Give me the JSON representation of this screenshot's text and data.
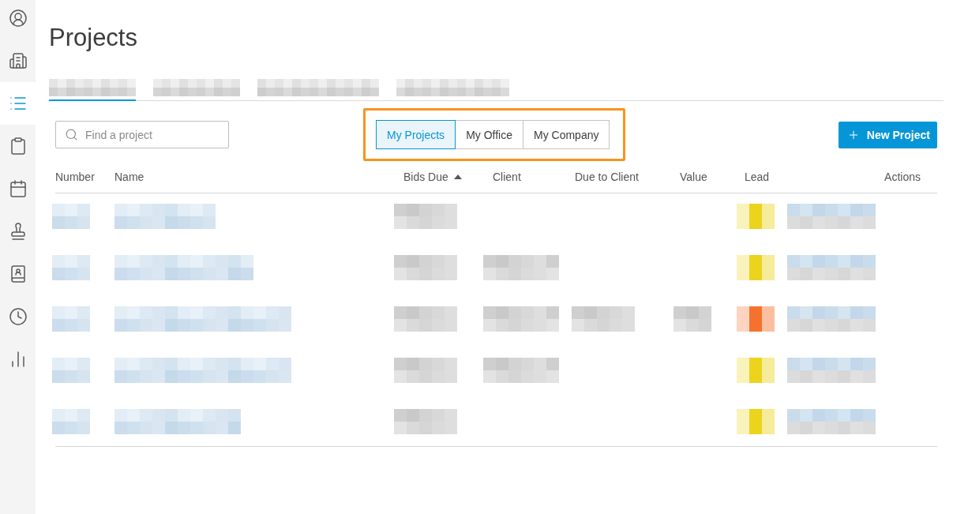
{
  "sidebar": {
    "items": [
      {
        "kind": "profile",
        "selected": false
      },
      {
        "kind": "buildings",
        "selected": false
      },
      {
        "kind": "list",
        "selected": true
      },
      {
        "kind": "clipboard",
        "selected": false
      },
      {
        "kind": "calendar",
        "selected": false
      },
      {
        "kind": "stamp",
        "selected": false
      },
      {
        "kind": "contacts",
        "selected": false
      },
      {
        "kind": "clock",
        "selected": false
      },
      {
        "kind": "chart",
        "selected": false
      }
    ]
  },
  "title": "Projects",
  "tabs": [
    {
      "selected": true
    },
    {
      "selected": false
    },
    {
      "selected": false
    },
    {
      "selected": false
    }
  ],
  "search": {
    "placeholder": "Find a project"
  },
  "scope_filter": {
    "highlighted": true,
    "options": [
      {
        "label": "My Projects",
        "selected": true
      },
      {
        "label": "My Office",
        "selected": false
      },
      {
        "label": "My Company",
        "selected": false
      }
    ]
  },
  "new_project_button": {
    "label": "New Project"
  },
  "table": {
    "columns": [
      {
        "label": "Number",
        "sorted": false
      },
      {
        "label": "Name",
        "sorted": false
      },
      {
        "label": "Bids Due",
        "sorted": true
      },
      {
        "label": "Client",
        "sorted": false
      },
      {
        "label": "Due to Client",
        "sorted": false
      },
      {
        "label": "Value",
        "sorted": false
      },
      {
        "label": "Lead",
        "sorted": false
      },
      {
        "label": "Actions",
        "sorted": false
      }
    ],
    "rows": [
      {
        "cells": [
          {
            "kind": "link"
          },
          {
            "kind": "link"
          },
          {
            "kind": "text"
          },
          {
            "kind": "empty"
          },
          {
            "kind": "empty"
          },
          {
            "kind": "empty"
          },
          {
            "kind": "lead",
            "color": "#ecd31c"
          },
          {
            "kind": "empty"
          }
        ]
      },
      {
        "cells": [
          {
            "kind": "link"
          },
          {
            "kind": "link"
          },
          {
            "kind": "text"
          },
          {
            "kind": "text"
          },
          {
            "kind": "empty"
          },
          {
            "kind": "empty"
          },
          {
            "kind": "lead",
            "color": "#ecd31c"
          },
          {
            "kind": "empty"
          }
        ]
      },
      {
        "cells": [
          {
            "kind": "link"
          },
          {
            "kind": "link"
          },
          {
            "kind": "text"
          },
          {
            "kind": "text"
          },
          {
            "kind": "text"
          },
          {
            "kind": "text"
          },
          {
            "kind": "lead",
            "color": "#f4722e"
          },
          {
            "kind": "empty"
          }
        ]
      },
      {
        "cells": [
          {
            "kind": "link"
          },
          {
            "kind": "link"
          },
          {
            "kind": "text"
          },
          {
            "kind": "text"
          },
          {
            "kind": "empty"
          },
          {
            "kind": "empty"
          },
          {
            "kind": "lead",
            "color": "#ecd31c"
          },
          {
            "kind": "empty"
          }
        ]
      },
      {
        "cells": [
          {
            "kind": "link"
          },
          {
            "kind": "link"
          },
          {
            "kind": "text"
          },
          {
            "kind": "empty"
          },
          {
            "kind": "empty"
          },
          {
            "kind": "empty"
          },
          {
            "kind": "lead",
            "color": "#ecd31c"
          },
          {
            "kind": "empty"
          }
        ]
      }
    ]
  }
}
